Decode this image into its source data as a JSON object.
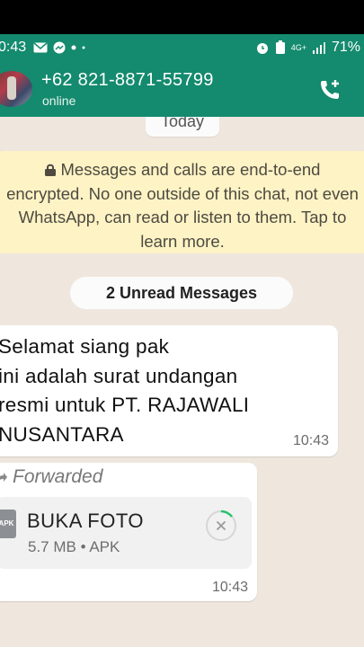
{
  "status_bar": {
    "time": "0:43",
    "network": "4G+",
    "battery": "71%"
  },
  "header": {
    "contact_name": "+62 821-8871-55799",
    "contact_status": "online"
  },
  "chat": {
    "date_chip": "Today",
    "encryption_notice": "Messages and calls are end-to-end encrypted. No one outside of this chat, not even WhatsApp, can read or listen to them. Tap to learn more.",
    "unread_label": "2 Unread Messages",
    "messages": [
      {
        "text": "Selamat siang pak\nini adalah surat undangan\nresmi untuk PT. RAJAWALI\nNUSANTARA",
        "time": "10:43"
      },
      {
        "forwarded_label": "Forwarded",
        "file_name": "BUKA FOTO",
        "file_meta": "5.7 MB • APK",
        "file_type": "APK",
        "time": "10:43"
      }
    ]
  },
  "colors": {
    "header_green": "#148a6e",
    "chat_bg": "#efe7de",
    "encryption_bg": "#fdf3c5"
  }
}
